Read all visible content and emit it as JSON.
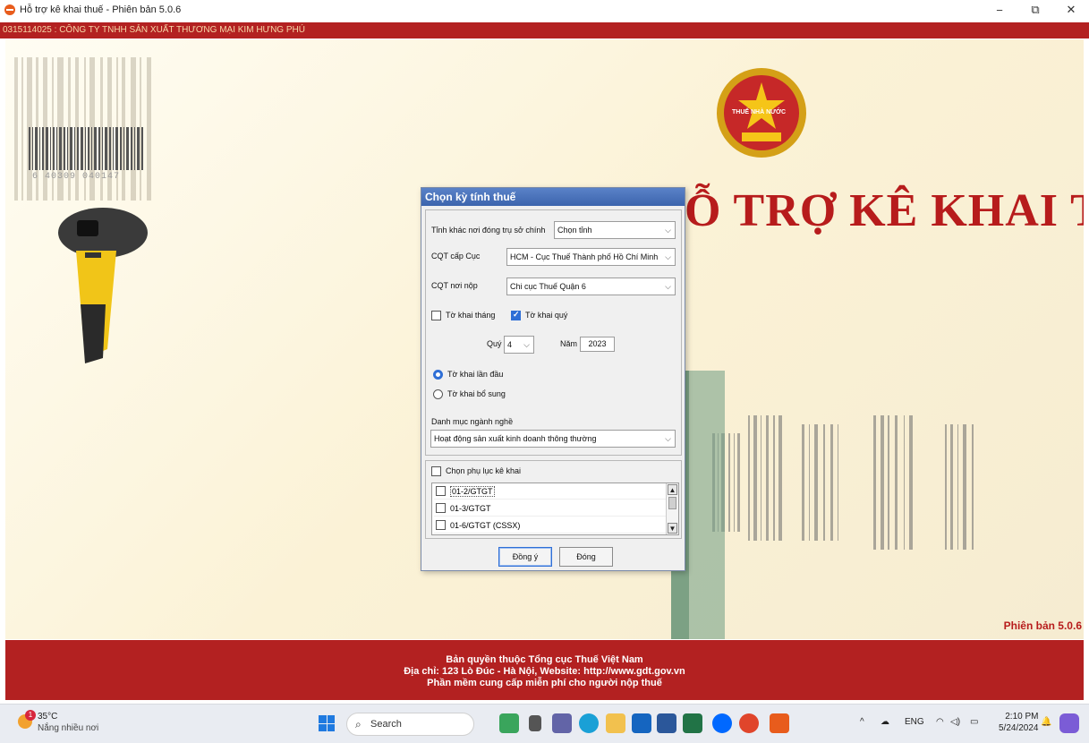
{
  "window": {
    "title": "Hỗ trợ kê khai thuế -  Phiên bản 5.0.6",
    "minimize": "−",
    "restore": "⧉",
    "close": "✕"
  },
  "company": "0315114025 : CÔNG TY TNHH SẢN XUẤT THƯƠNG MẠI KIM HƯNG PHÚ",
  "banner": {
    "title": "Ỗ TRỢ KÊ KHAI THUẾ",
    "emblem_text": "THUẾ NHÀ NƯỚC",
    "barcode_number": "6 40309 040147",
    "version": "Phiên bản 5.0.6"
  },
  "dialog": {
    "title": "Chọn kỳ tính thuế",
    "province_label": "Tỉnh khác nơi đóng trụ sở chính",
    "province_value": "Chọn tỉnh",
    "cqt_cuc_label": "CQT cấp Cục",
    "cqt_cuc_value": "HCM - Cục Thuế Thành phố Hồ Chí Minh",
    "cqt_noi_nop_label": "CQT nơi nộp",
    "cqt_noi_nop_value": "Chi cục Thuế Quận 6",
    "monthly_label": "Tờ khai tháng",
    "monthly_checked": false,
    "quarterly_label": "Tờ khai quý",
    "quarterly_checked": true,
    "quarter_label": "Quý",
    "quarter_value": "4",
    "year_label": "Năm",
    "year_value": "2023",
    "first_label": "Tờ khai lần đầu",
    "supplement_label": "Tờ khai bổ sung",
    "selected_type": "first",
    "industry_label": "Danh mục ngành nghề",
    "industry_value": "Hoạt động sản xuất kinh doanh thông thường",
    "appendix_label": "Chọn phụ lục kê khai",
    "appendix_items": [
      "01-2/GTGT",
      "01-3/GTGT",
      "01-6/GTGT (CSSX)"
    ],
    "ok_button": "Đồng ý",
    "close_button": "Đóng"
  },
  "footer": {
    "line1": "Bản quyền thuộc Tổng cục Thuế Việt Nam",
    "line2": "Địa chỉ: 123 Lò Đúc - Hà Nội, Website: http://www.gdt.gov.vn",
    "line3": "Phần mềm cung cấp miễn phí cho người nộp thuế"
  },
  "taskbar": {
    "weather_badge": "1",
    "temperature": "35°C",
    "weather_desc": "Nắng nhiều nơi",
    "search_placeholder": "Search",
    "tray_caret": "^",
    "language": "ENG",
    "time": "2:10 PM",
    "date": "5/24/2024"
  },
  "colors": {
    "brand_red": "#b32121",
    "title_red": "#b71c1c",
    "dialog_title": "#3c64ad",
    "accent_blue": "#2f6fd6"
  }
}
